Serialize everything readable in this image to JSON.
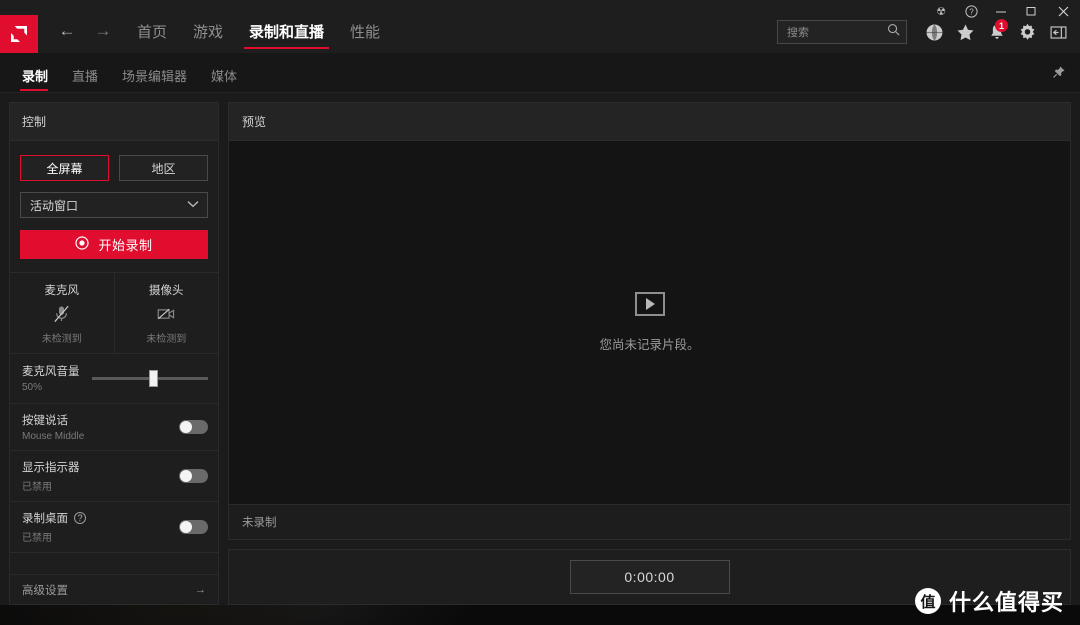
{
  "window": {
    "controls": [
      {
        "name": "bug-icon",
        "glyph": "☢"
      },
      {
        "name": "help-icon",
        "glyph": "?"
      },
      {
        "name": "minimize-icon",
        "glyph": "—"
      },
      {
        "name": "maximize-icon",
        "glyph": "□"
      },
      {
        "name": "close-icon",
        "glyph": "✕"
      }
    ]
  },
  "header": {
    "back_label": "←",
    "forward_label": "→",
    "tabs": [
      {
        "label": "首页",
        "active": false
      },
      {
        "label": "游戏",
        "active": false
      },
      {
        "label": "录制和直播",
        "active": true
      },
      {
        "label": "性能",
        "active": false
      }
    ],
    "search": {
      "placeholder": "搜索",
      "value": ""
    },
    "tools": [
      {
        "name": "globe-icon",
        "label": ""
      },
      {
        "name": "star-icon",
        "label": ""
      },
      {
        "name": "bell-icon",
        "label": "",
        "badge": "1"
      },
      {
        "name": "gear-icon",
        "label": ""
      },
      {
        "name": "panel-toggle-icon",
        "label": ""
      }
    ]
  },
  "subtabs": {
    "items": [
      {
        "label": "录制",
        "active": true
      },
      {
        "label": "直播",
        "active": false
      },
      {
        "label": "场景编辑器",
        "active": false
      },
      {
        "label": "媒体",
        "active": false
      }
    ],
    "pin_name": "pin-icon"
  },
  "control_panel": {
    "title": "控制",
    "mode_buttons": [
      {
        "label": "全屏幕",
        "selected": true
      },
      {
        "label": "地区",
        "selected": false
      }
    ],
    "source_dropdown": {
      "value": "活动窗口"
    },
    "record_button": {
      "label": "开始录制"
    },
    "devices": [
      {
        "name": "麦克风",
        "status": "未检测到",
        "icon": "microphone-muted-icon"
      },
      {
        "name": "摄像头",
        "status": "未检测到",
        "icon": "camera-off-icon"
      }
    ],
    "volume": {
      "label": "麦克风音量",
      "value": "50%",
      "percent": 50
    },
    "toggles": [
      {
        "label": "按键说话",
        "sub": "Mouse Middle",
        "on": false,
        "help": false
      },
      {
        "label": "显示指示器",
        "sub": "已禁用",
        "on": false,
        "help": false
      },
      {
        "label": "录制桌面",
        "sub": "已禁用",
        "on": false,
        "help": true
      }
    ],
    "advanced": {
      "label": "高级设置",
      "arrow": "→"
    }
  },
  "preview": {
    "title": "预览",
    "empty_message": "您尚未记录片段。",
    "status": "未录制"
  },
  "timer": {
    "value": "0:00:00"
  },
  "watermark": {
    "logo": "值",
    "text": "什么值得买"
  },
  "colors": {
    "accent": "#e00d2e",
    "panel": "#1e1e1e",
    "window": "#1b1b1b"
  }
}
